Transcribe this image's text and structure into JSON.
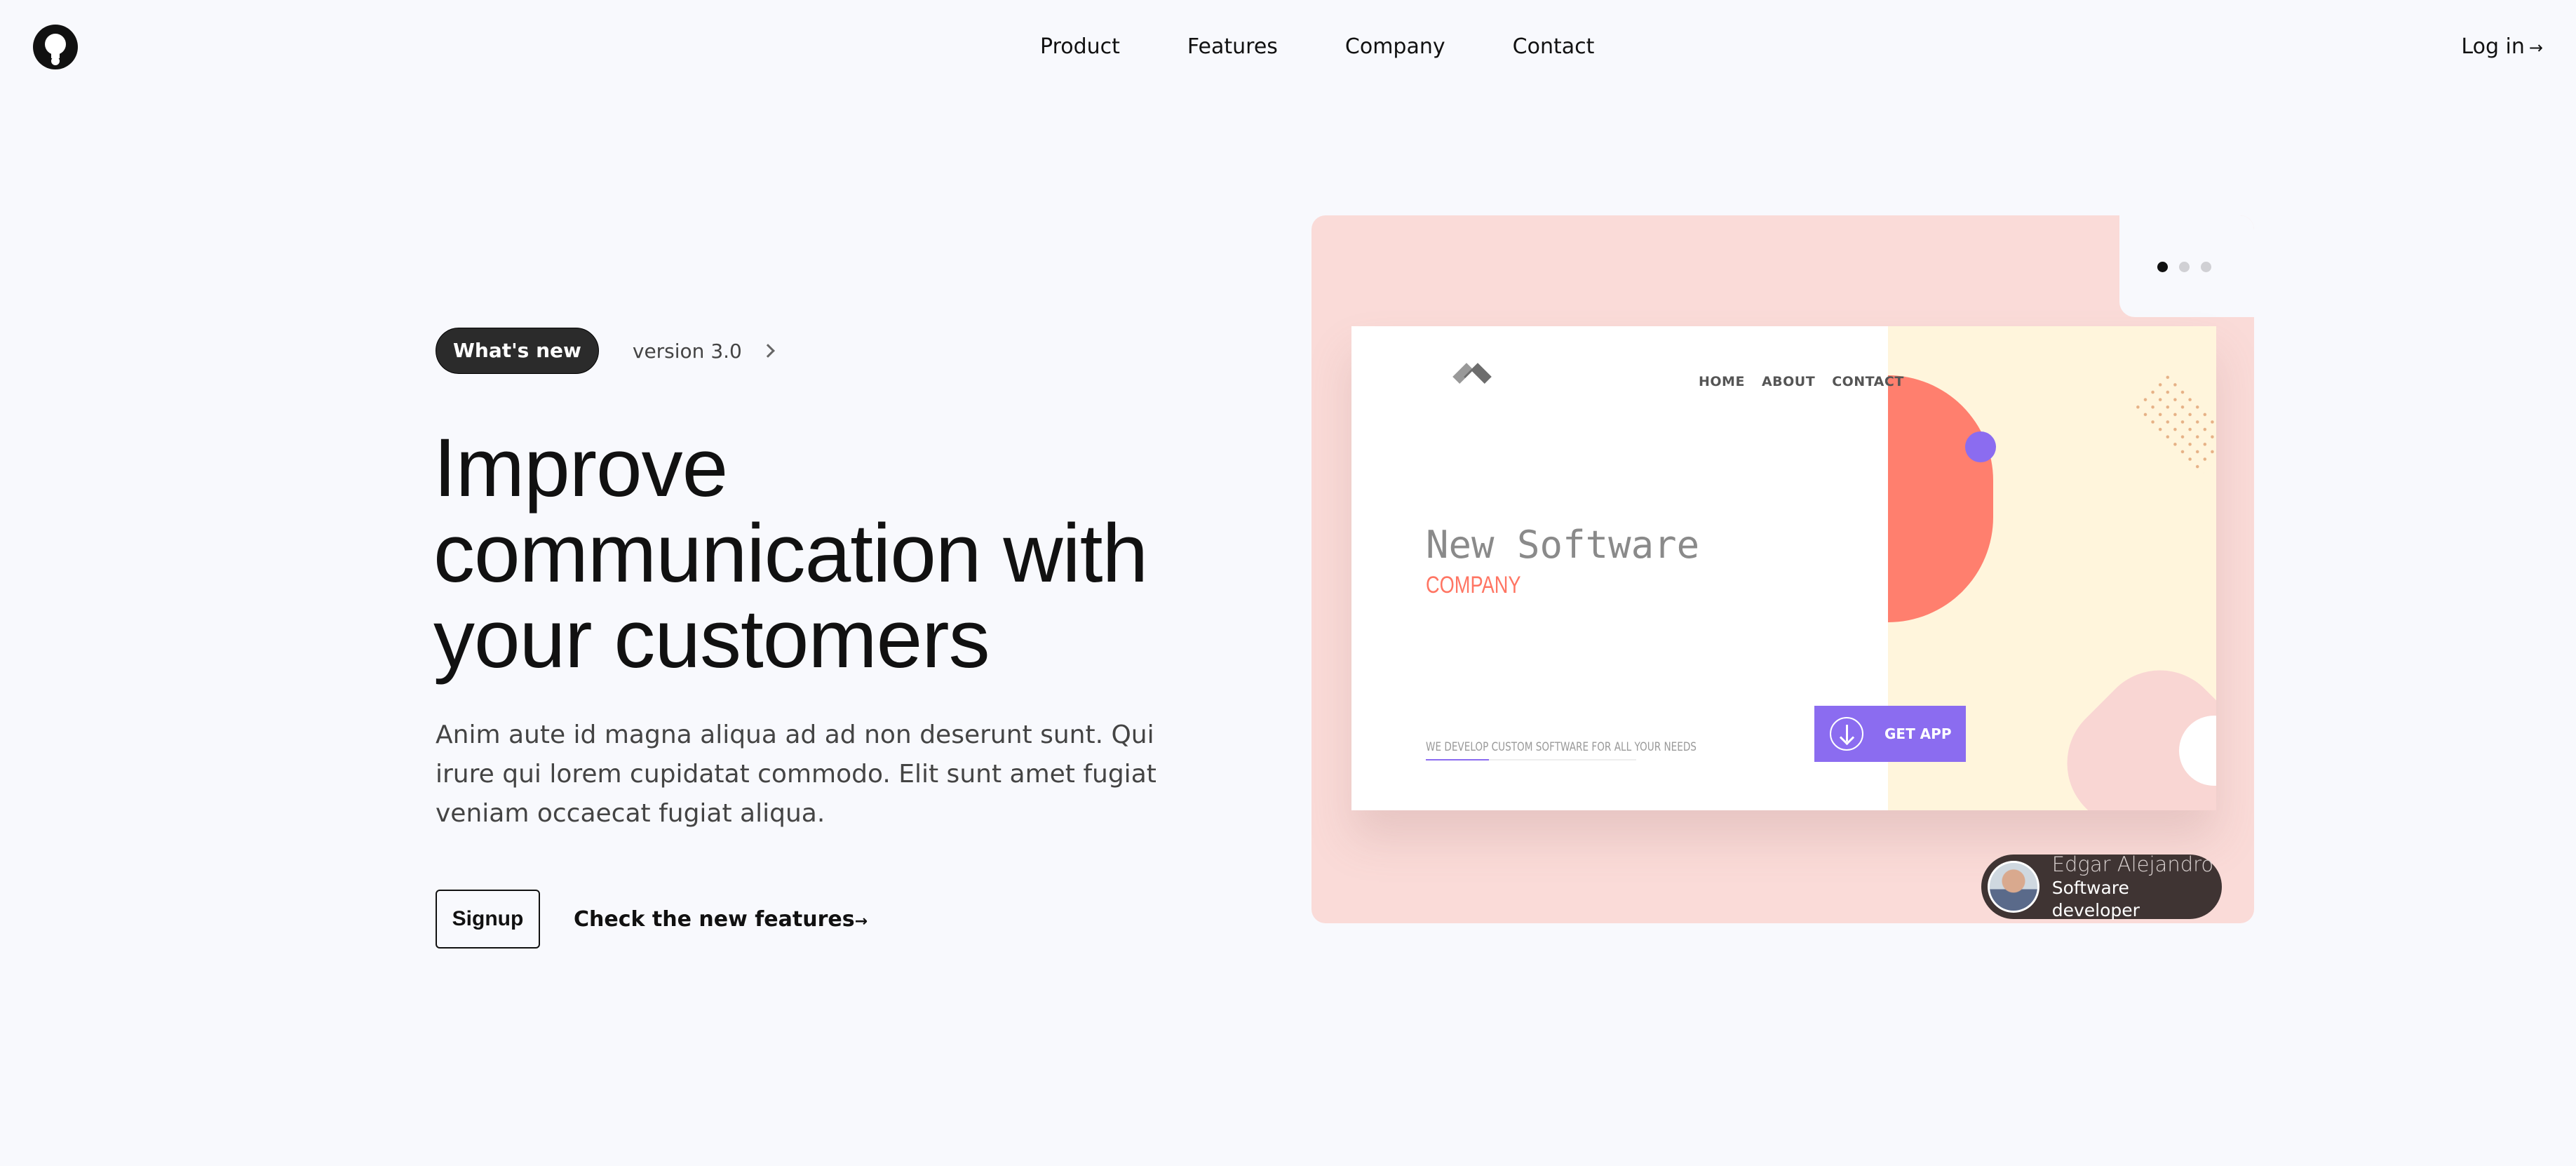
{
  "nav": {
    "items": [
      "Product",
      "Features",
      "Company",
      "Contact"
    ],
    "login": "Log in",
    "login_arrow": "→"
  },
  "hero": {
    "badge": "What's new",
    "version": "version 3.0",
    "headline": [
      "Improve",
      "communication with",
      "your customers"
    ],
    "lead": "Anim aute id magna aliqua ad ad non deserunt sunt. Qui irure qui lorem cupidatat commodo. Elit sunt amet fugiat veniam occaecat fugiat aliqua.",
    "signup": "Signup",
    "check": "Check the new features",
    "check_arrow": "→"
  },
  "showcase": {
    "slides": 3,
    "active_slide": 1,
    "mock": {
      "nav": [
        "HOME",
        "ABOUT",
        "CONTACT"
      ],
      "title": "New Software",
      "subtitle": "COMPANY",
      "tagline": "WE DEVELOP CUSTOM SOFTWARE FOR ALL YOUR NEEDS",
      "cta": "GET APP"
    },
    "author": {
      "name": "Edgar Alejandro",
      "role": "Software developer"
    }
  },
  "colors": {
    "background": "#f8f9fd",
    "showcase_bg": "#fadbd8",
    "accent_purple": "#8b6cf0",
    "accent_coral": "#ff7f6e",
    "badge_bg": "#2b2b2b"
  }
}
